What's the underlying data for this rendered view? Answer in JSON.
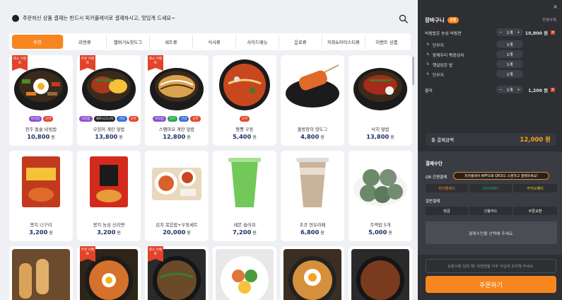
{
  "notice": "주문하신 상품 결제는 반드시 피카플레이로 결제하시고, 맛있게 드세요~",
  "tabs": [
    "추천",
    "라면류",
    "햄버거&핫도그",
    "세트류",
    "식사류",
    "사이드메뉴",
    "음료류",
    "커피&아이스티류",
    "이벤트 상품"
  ],
  "currency": "원",
  "menu": [
    {
      "name": "전주 돌솥 비빔밥",
      "price": "10,800",
      "ribbon": "퀵스 이벤트",
      "tags": [
        {
          "t": "미디엄",
          "c": "#8a4fd1"
        },
        {
          "t": "순한",
          "c": "#e2432a"
        }
      ],
      "food": "bibim"
    },
    {
      "name": "오징어 계란 덮밥",
      "price": "13,800",
      "ribbon": "주문 이벤트",
      "tags": [
        {
          "t": "미디엄",
          "c": "#8a4fd1"
        },
        {
          "t": "셰프시그니처",
          "c": "#222"
        },
        {
          "t": "건강",
          "c": "#3a6ad6"
        },
        {
          "t": "순한",
          "c": "#e2432a"
        }
      ],
      "food": "squid"
    },
    {
      "name": "스팸마요 계란 덮밥",
      "price": "12,800",
      "ribbon": "퀵스 이벤트",
      "tags": [
        {
          "t": "미디엄",
          "c": "#8a4fd1"
        },
        {
          "t": "인기",
          "c": "#2ca34b"
        },
        {
          "t": "건강",
          "c": "#3a6ad6"
        },
        {
          "t": "순한",
          "c": "#e2432a"
        }
      ],
      "food": "spam"
    },
    {
      "name": "짬뽕 우동",
      "price": "5,400",
      "ribbon": "",
      "tags": [
        {
          "t": "순한",
          "c": "#e2432a"
        }
      ],
      "food": "udon"
    },
    {
      "name": "불방망이 핫도그",
      "price": "4,800",
      "ribbon": "",
      "tags": [],
      "food": "hotdog"
    },
    {
      "name": "낙지 덮밥",
      "price": "13,800",
      "ribbon": "",
      "tags": [],
      "food": "octopus"
    },
    {
      "name": "봉지 너구리",
      "price": "3,200",
      "ribbon": "",
      "tags": [],
      "food": "neoguri"
    },
    {
      "name": "봉지 농심 신라면",
      "price": "3,200",
      "ribbon": "",
      "tags": [],
      "food": "shin"
    },
    {
      "name": "김치 볶음밥+우동세트",
      "price": "20,000",
      "ribbon": "",
      "tags": [],
      "food": "set"
    },
    {
      "name": "레몬 슬러쉬",
      "price": "7,200",
      "ribbon": "",
      "tags": [],
      "food": "slush"
    },
    {
      "name": "초코 연유라떼",
      "price": "6,800",
      "ribbon": "",
      "tags": [],
      "food": "latte"
    },
    {
      "name": "주먹밥 5개",
      "price": "5,000",
      "ribbon": "",
      "tags": [],
      "food": "riceball"
    },
    {
      "name": "",
      "price": "",
      "ribbon": "",
      "tags": [],
      "food": "corndog"
    },
    {
      "name": "",
      "price": "",
      "ribbon": "주문 이벤트",
      "tags": [],
      "food": "ramen"
    },
    {
      "name": "",
      "price": "",
      "ribbon": "퀵스 이벤트",
      "tags": [],
      "food": "noodle"
    },
    {
      "name": "",
      "price": "",
      "ribbon": "",
      "tags": [],
      "food": "poke"
    },
    {
      "name": "",
      "price": "",
      "ribbon": "",
      "tags": [],
      "food": "egg"
    },
    {
      "name": "",
      "price": "",
      "ribbon": "",
      "tags": [],
      "food": "dark"
    }
  ],
  "cart": {
    "title": "장바구니",
    "count": "2개",
    "clear": "전체삭제",
    "close": "×",
    "items": [
      {
        "name": "비빔밥은 농심 비빔면",
        "qty": "1개",
        "price": "10,800 원",
        "main": true,
        "sub": false
      },
      {
        "name": "단무지",
        "qty": "1개",
        "price": "",
        "main": false,
        "sub": true
      },
      {
        "name": "참깨우리 볶음김치",
        "qty": "1개",
        "price": "",
        "main": false,
        "sub": true
      },
      {
        "name": "햇살담은 밥",
        "qty": "1개",
        "price": "",
        "main": false,
        "sub": true
      },
      {
        "name": "단무지",
        "qty": "1개",
        "price": "",
        "main": false,
        "sub": true
      },
      {
        "name": "콜라",
        "qty": "1개",
        "price": "1,200 원",
        "main": true,
        "sub": false
      }
    ],
    "total_label": "총 결제금액",
    "total_amount": "12,000 원"
  },
  "payment": {
    "title": "결제수단",
    "qr_label": "QR 간편결제",
    "qr_note": "피카플레이 APP으로 QR코드 스캔하고 결제하세요!",
    "qr_options": [
      "피카플레이",
      "네이버페이",
      "카카오페이"
    ],
    "general_label": "일반결제",
    "general_options": [
      "현금",
      "신용카드",
      "쿠폰교환"
    ],
    "select_msg": "결제수단을 선택해 주세요."
  },
  "memo_placeholder": "요청사항 입력 예) 비빔면을 아주 차갑게 조리해 주세요.",
  "order_button": "주문하기",
  "colors": {
    "accent": "#f7861e",
    "price": "#1e3163",
    "ribbon": "#e2432a",
    "panel": "#2d2f33"
  }
}
